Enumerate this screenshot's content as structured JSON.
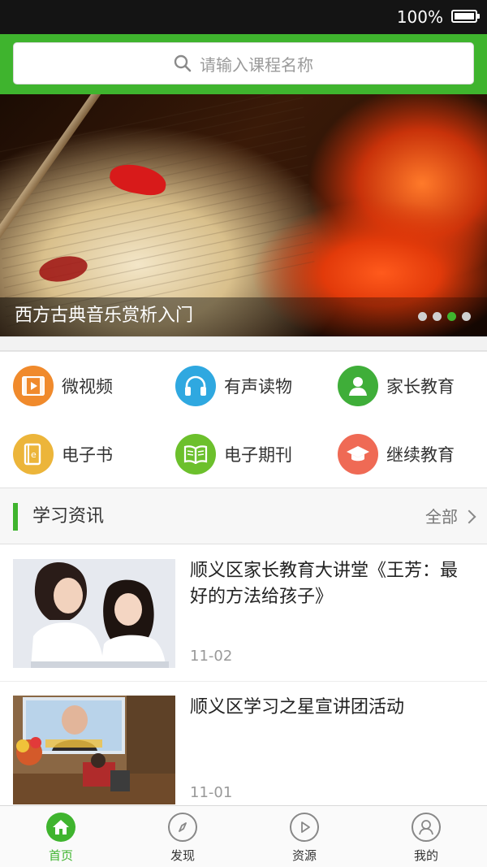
{
  "status_bar": {
    "battery_text": "100%"
  },
  "search": {
    "placeholder": "请输入课程名称"
  },
  "banner": {
    "title": "西方古典音乐赏析入门",
    "dot_count": 4,
    "active_dot_index": 2
  },
  "categories": [
    {
      "label": "微视频",
      "icon": "video-icon",
      "color": "#f08a2c"
    },
    {
      "label": "有声读物",
      "icon": "headphones-icon",
      "color": "#2fa8e0"
    },
    {
      "label": "家长教育",
      "icon": "user-icon",
      "color": "#3fae39"
    },
    {
      "label": "电子书",
      "icon": "ebook-icon",
      "color": "#ecb53a"
    },
    {
      "label": "电子期刊",
      "icon": "open-book-icon",
      "color": "#6cc02c"
    },
    {
      "label": "继续教育",
      "icon": "graduation-cap-icon",
      "color": "#ef6a55"
    }
  ],
  "news_section": {
    "title": "学习资讯",
    "more_label": "全部"
  },
  "news": [
    {
      "title": "顺义区家长教育大讲堂《王芳：最好的方法给孩子》",
      "date": "11-02"
    },
    {
      "title": "顺义区学习之星宣讲团活动",
      "date": "11-01"
    }
  ],
  "tabs": [
    {
      "label": "首页",
      "icon": "home-icon",
      "active": true
    },
    {
      "label": "发现",
      "icon": "compass-icon",
      "active": false
    },
    {
      "label": "资源",
      "icon": "play-icon",
      "active": false
    },
    {
      "label": "我的",
      "icon": "profile-icon",
      "active": false
    }
  ],
  "colors": {
    "accent": "#3fb42e",
    "status_bar": "#141414"
  }
}
